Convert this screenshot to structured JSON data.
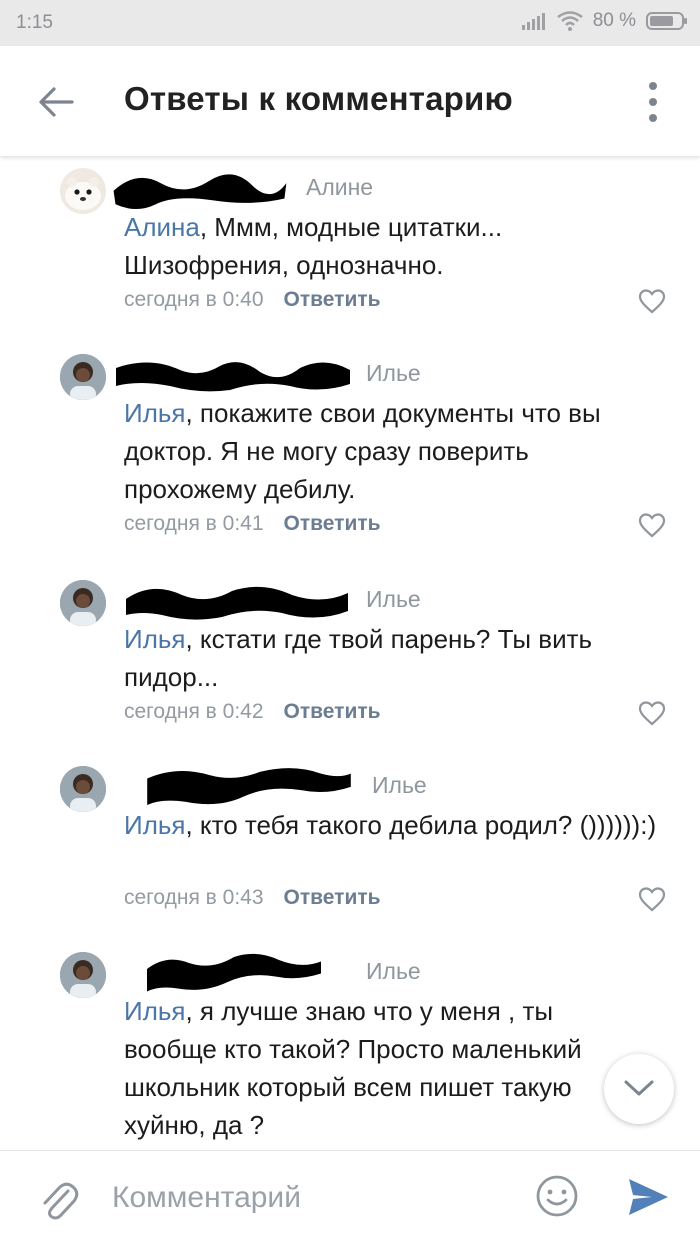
{
  "status_bar": {
    "time": "1:15",
    "battery_text": "80 %",
    "battery_level": 0.8,
    "icons": [
      "signal-icon",
      "wifi-icon",
      "battery-icon"
    ]
  },
  "header": {
    "back_icon": "arrow-left-icon",
    "title": "Ответы к комментарию",
    "more_icon": "more-vertical-icon"
  },
  "comments": [
    {
      "reply_to": "Алине",
      "mention": "Алина",
      "text": ", Ммм, модные цитатки... Шизофрения, однозначно.",
      "time": "сегодня в 0:40",
      "reply_label": "Ответить"
    },
    {
      "reply_to": "Илье",
      "mention": "Илья",
      "text": ", покажите свои документы что вы доктор. Я не могу сразу поверить прохожему дебилу.",
      "time": "сегодня в 0:41",
      "reply_label": "Ответить"
    },
    {
      "reply_to": "Илье",
      "mention": "Илья",
      "text": ", кстати где твой парень? Ты вить пидор...",
      "time": "сегодня в 0:42",
      "reply_label": "Ответить"
    },
    {
      "reply_to": "Илье",
      "mention": "Илья",
      "text": ", кто тебя такого дебила родил? ()))))):)",
      "time": "сегодня в 0:43",
      "reply_label": "Ответить"
    },
    {
      "reply_to": "Илье",
      "mention": "Илья",
      "text": ", я лучше знаю что у меня , ты вообще кто такой? Просто маленький школьник который всем пишет такую хуйню, да ?"
    }
  ],
  "composer": {
    "placeholder": "Комментарий",
    "attach_icon": "paperclip-icon",
    "emoji_icon": "emoji-icon",
    "send_icon": "send-icon"
  },
  "scroll_down_icon": "chevron-down-icon",
  "colors": {
    "accent": "#4a76a8",
    "send": "#5181b8",
    "status_bar_bg": "#e9e9ea"
  }
}
